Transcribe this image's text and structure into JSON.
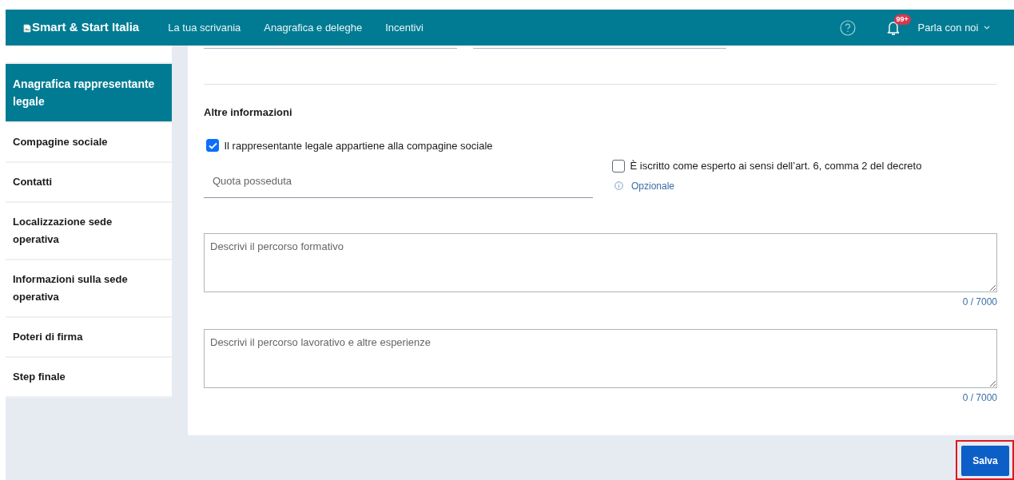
{
  "header": {
    "brand": "Smart & Start Italia",
    "nav": [
      "La tua scrivania",
      "Anagrafica e deleghe",
      "Incentivi"
    ],
    "notifications_badge": "99+",
    "user_menu": "Parla con noi"
  },
  "sidebar": {
    "items": [
      {
        "label": "Anagrafica rappresentante legale",
        "selected": true
      },
      {
        "label": "Compagine sociale",
        "selected": false
      },
      {
        "label": "Contatti",
        "selected": false
      },
      {
        "label": "Localizzazione sede operativa",
        "selected": false
      },
      {
        "label": "Informazioni sulla sede operativa",
        "selected": false
      },
      {
        "label": "Poteri di firma",
        "selected": false
      },
      {
        "label": "Step finale",
        "selected": false
      }
    ]
  },
  "form": {
    "section_title": "Altre informazioni",
    "member_checkbox": {
      "label": "Il rappresentante legale appartiene alla compagine sociale",
      "checked": true
    },
    "share_field": {
      "placeholder": "Quota posseduta"
    },
    "expert_checkbox": {
      "label": "È iscritto come esperto ai sensi dell’art. 6, comma 2 del decreto",
      "checked": false
    },
    "hint": "Opzionale",
    "textareas": [
      {
        "placeholder": "Descrivi il percorso formativo",
        "counter": "0 / 7000"
      },
      {
        "placeholder": "Descrivi il percorso lavorativo e altre esperienze",
        "counter": "0 / 7000"
      }
    ]
  },
  "save_button": "Salva"
}
